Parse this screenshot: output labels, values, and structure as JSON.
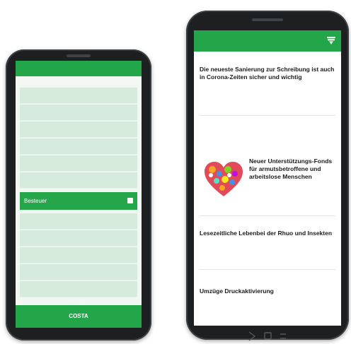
{
  "left_app": {
    "header_title": "",
    "highlighted_item": {
      "label": "Besteuer"
    },
    "footer_button": {
      "label": "COSTA"
    }
  },
  "right_app": {
    "header_title": "",
    "header_icon": "filter-icon",
    "articles": [
      {
        "title": "Die neueste Sanierung zur Schreibung ist auch in Corona-Zeiten sicher und wichtig",
        "meta": ""
      },
      {
        "title": "Neuer Unterstützungs-Fonds für armutsbetroffene und arbeitslose Menschen",
        "meta": ""
      },
      {
        "title": "Lesezeitliche Lebenbei der Rhuo und Insekten",
        "meta": ""
      },
      {
        "title": "Umzüge Druckaktivierung",
        "meta": ""
      }
    ]
  },
  "colors": {
    "brand_green": "#23a54a",
    "menu_light": "#d7ebdc"
  }
}
